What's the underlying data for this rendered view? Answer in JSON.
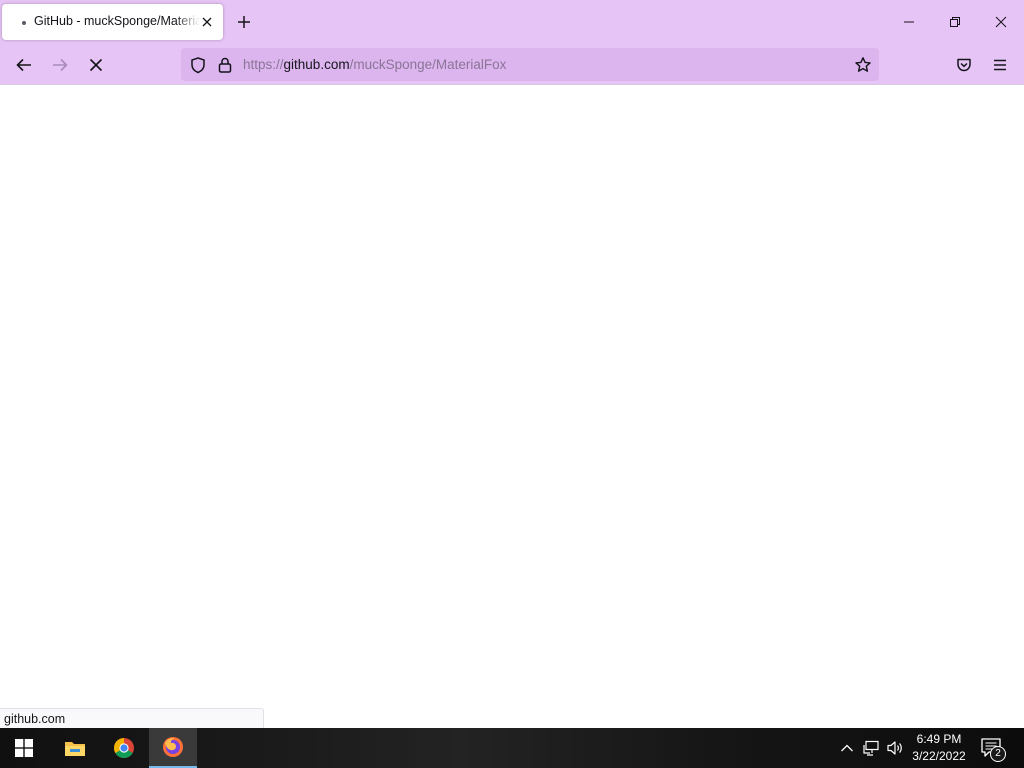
{
  "browser": {
    "tab": {
      "title": "GitHub - muckSponge/MaterialFox"
    },
    "url": {
      "scheme": "https://",
      "host": "github.com",
      "path": "/muckSponge/MaterialFox"
    },
    "status_text": "github.com"
  },
  "taskbar": {
    "time": "6:49 PM",
    "date": "3/22/2022",
    "notification_count": "2"
  },
  "icons": {
    "tab": [
      "tab-loading-dot-icon",
      "tab-close-icon",
      "new-tab-icon"
    ],
    "window": [
      "minimize-icon",
      "restore-icon",
      "close-icon"
    ],
    "nav": [
      "back-arrow-icon",
      "forward-arrow-icon",
      "stop-loading-icon",
      "shield-icon",
      "lock-icon",
      "bookmark-star-icon",
      "pocket-icon",
      "hamburger-menu-icon"
    ],
    "taskbar": [
      "windows-start-icon",
      "file-explorer-icon",
      "chrome-icon",
      "firefox-icon",
      "chevron-up-icon",
      "network-icon",
      "volume-icon",
      "notification-icon"
    ]
  },
  "colors": {
    "toolbar": "#e6c4f5",
    "urlbar": "#dcb5ef",
    "active_task_underline": "#76b9ed"
  }
}
